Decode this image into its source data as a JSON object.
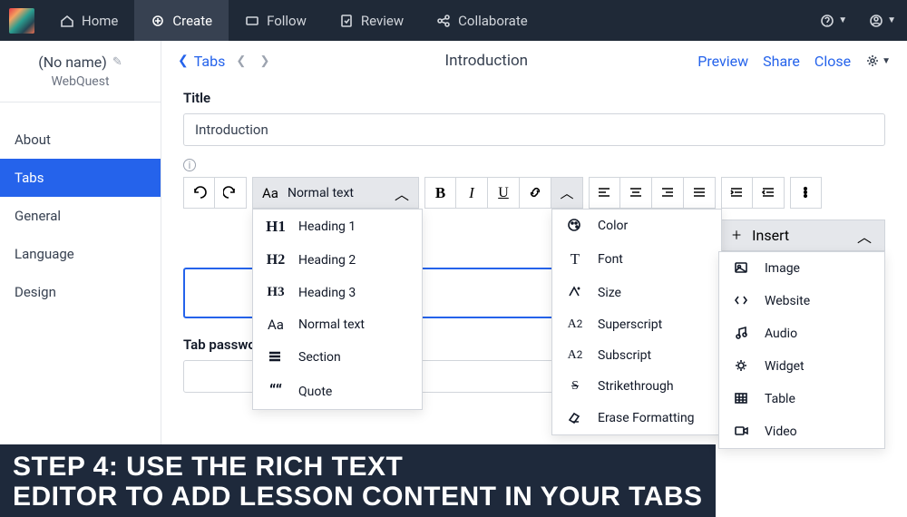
{
  "topnav": {
    "items": [
      {
        "icon": "home",
        "label": "Home"
      },
      {
        "icon": "create",
        "label": "Create"
      },
      {
        "icon": "follow",
        "label": "Follow"
      },
      {
        "icon": "review",
        "label": "Review"
      },
      {
        "icon": "collaborate",
        "label": "Collaborate"
      }
    ]
  },
  "sidebar": {
    "project_name": "(No name)",
    "project_type": "WebQuest",
    "menu": [
      "About",
      "Tabs",
      "General",
      "Language",
      "Design"
    ]
  },
  "header": {
    "back": "Tabs",
    "title": "Introduction",
    "actions": [
      "Preview",
      "Share",
      "Close"
    ]
  },
  "form": {
    "title_label": "Title",
    "title_value": "Introduction",
    "tab_password_label": "Tab password"
  },
  "toolbar": {
    "style_button": "Normal text",
    "insert_button": "Insert"
  },
  "style_menu": [
    "Heading 1",
    "Heading 2",
    "Heading 3",
    "Normal text",
    "Section",
    "Quote"
  ],
  "format_menu": [
    "Color",
    "Font",
    "Size",
    "Superscript",
    "Subscript",
    "Strikethrough",
    "Erase Formatting"
  ],
  "insert_menu": [
    "Image",
    "Website",
    "Audio",
    "Widget",
    "Table",
    "Video"
  ],
  "banner": {
    "line1": "Step 4: Use the rich text",
    "line2": "editor to add lesson content in your tabs"
  }
}
